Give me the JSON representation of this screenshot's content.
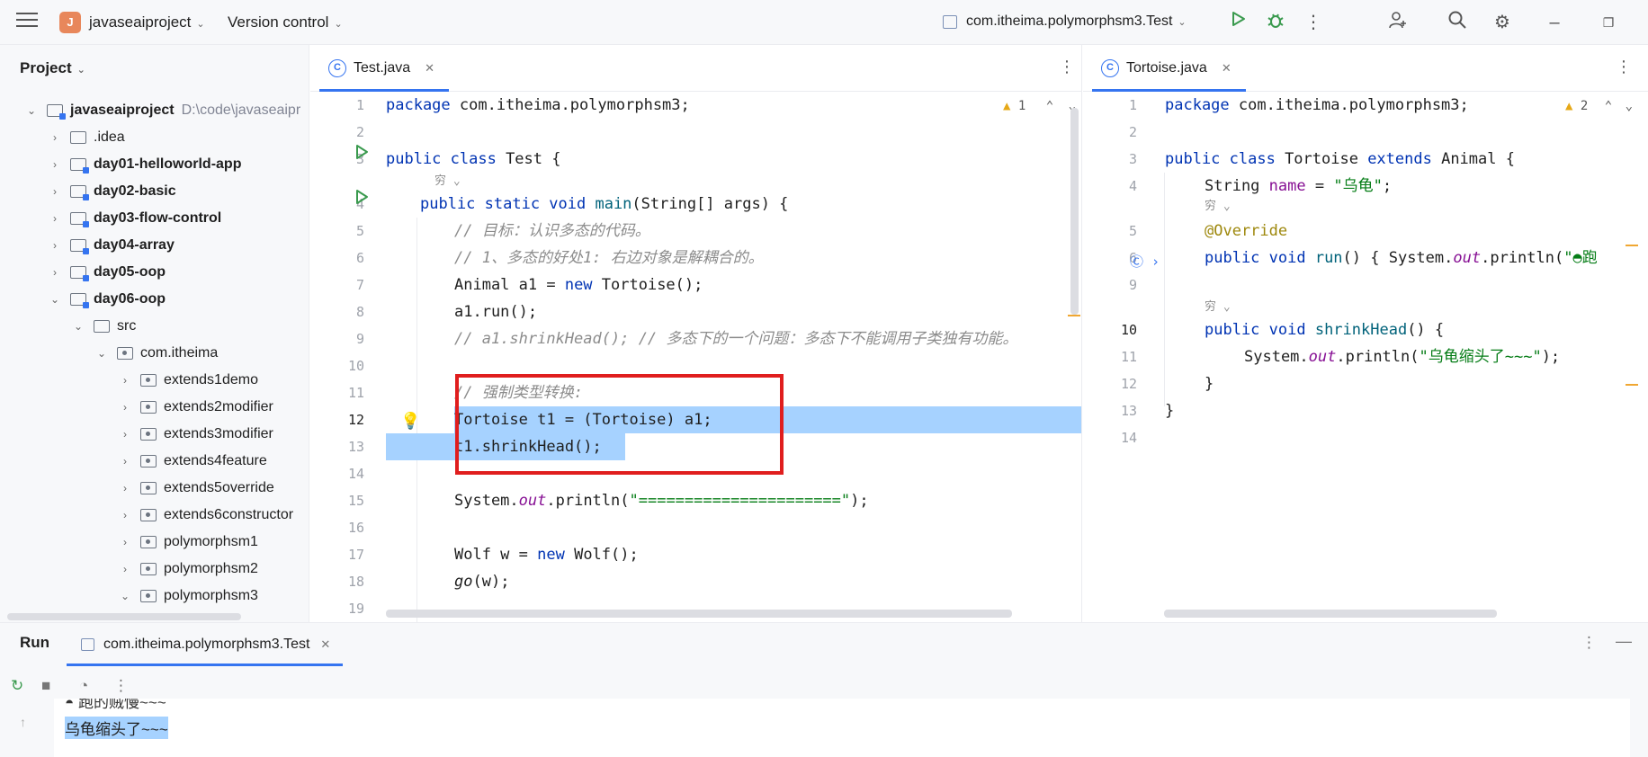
{
  "titlebar": {
    "project_badge": "J",
    "project_name": "javaseaiproject",
    "version_control": "Version control",
    "run_config": "com.itheima.polymorphsm3.Test"
  },
  "project_panel": {
    "header": "Project",
    "tree": [
      {
        "label": "javaseaiproject",
        "path": "D:\\code\\javaseaipr",
        "level": 0,
        "expanded": true,
        "icon": "module-folder-icon",
        "bold": true
      },
      {
        "label": ".idea",
        "level": 1,
        "expanded": false,
        "icon": "folder-icon",
        "bold": false
      },
      {
        "label": "day01-helloworld-app",
        "level": 1,
        "expanded": false,
        "icon": "module-folder-icon",
        "bold": true
      },
      {
        "label": "day02-basic",
        "level": 1,
        "expanded": false,
        "icon": "module-folder-icon",
        "bold": true
      },
      {
        "label": "day03-flow-control",
        "level": 1,
        "expanded": false,
        "icon": "module-folder-icon",
        "bold": true
      },
      {
        "label": "day04-array",
        "level": 1,
        "expanded": false,
        "icon": "module-folder-icon",
        "bold": true
      },
      {
        "label": "day05-oop",
        "level": 1,
        "expanded": false,
        "icon": "module-folder-icon",
        "bold": true
      },
      {
        "label": "day06-oop",
        "level": 1,
        "expanded": true,
        "icon": "module-folder-icon",
        "bold": true
      },
      {
        "label": "src",
        "level": 2,
        "expanded": true,
        "icon": "source-folder-icon",
        "bold": false
      },
      {
        "label": "com.itheima",
        "level": 3,
        "expanded": true,
        "icon": "package-icon",
        "bold": false
      },
      {
        "label": "extends1demo",
        "level": 4,
        "expanded": false,
        "icon": "package-icon",
        "bold": false
      },
      {
        "label": "extends2modifier",
        "level": 4,
        "expanded": false,
        "icon": "package-icon",
        "bold": false
      },
      {
        "label": "extends3modifier",
        "level": 4,
        "expanded": false,
        "icon": "package-icon",
        "bold": false
      },
      {
        "label": "extends4feature",
        "level": 4,
        "expanded": false,
        "icon": "package-icon",
        "bold": false
      },
      {
        "label": "extends5override",
        "level": 4,
        "expanded": false,
        "icon": "package-icon",
        "bold": false
      },
      {
        "label": "extends6constructor",
        "level": 4,
        "expanded": false,
        "icon": "package-icon",
        "bold": false
      },
      {
        "label": "polymorphsm1",
        "level": 4,
        "expanded": false,
        "icon": "package-icon",
        "bold": false
      },
      {
        "label": "polymorphsm2",
        "level": 4,
        "expanded": false,
        "icon": "package-icon",
        "bold": false
      },
      {
        "label": "polymorphsm3",
        "level": 4,
        "expanded": true,
        "icon": "package-icon",
        "bold": false
      }
    ]
  },
  "left_editor": {
    "tab_label": "Test.java",
    "warnings": "1",
    "line_numbers": [
      "1",
      "2",
      "3",
      "4",
      "5",
      "6",
      "7",
      "8",
      "9",
      "10",
      "11",
      "12",
      "13",
      "14",
      "15",
      "16",
      "17",
      "18",
      "19"
    ],
    "code": {
      "l1_kw": "package",
      "l1_rest": " com.itheima.polymorphsm3;",
      "l3_kw": "public class",
      "l3_rest": " Test {",
      "l4_hint": "穷",
      "l4_kw": "public static void",
      "l4_fn": " main",
      "l4_rest": "(String[] args) {",
      "l5": "// 目标：认识多态的代码。",
      "l6": "// 1、多态的好处1: 右边对象是解耦合的。",
      "l7_a": "Animal a1 = ",
      "l7_kw": "new",
      "l7_b": " Tortoise();",
      "l8": "a1.run();",
      "l9": "// a1.shrinkHead(); // 多态下的一个问题：多态下不能调用子类独有功能。",
      "l11": "// 强制类型转换:",
      "l12": "Tortoise t1 = (Tortoise) a1;",
      "l13": "t1.shrinkHead();",
      "l15_a": "System.",
      "l15_st": "out",
      "l15_b": ".println(",
      "l15_str": "\"======================\"",
      "l15_c": ");",
      "l17_a": "Wolf w = ",
      "l17_kw": "new",
      "l17_b": " Wolf();",
      "l18_fn": "go",
      "l18_b": "(w);"
    }
  },
  "right_editor": {
    "tab_label": "Tortoise.java",
    "warnings": "2",
    "line_numbers": [
      "1",
      "2",
      "3",
      "4",
      "5",
      "6",
      "9",
      "10",
      "11",
      "12",
      "13",
      "14"
    ],
    "code": {
      "l1_kw": "package",
      "l1_rest": " com.itheima.polymorphsm3;",
      "l3_kw": "public class",
      "l3_a": " Tortoise ",
      "l3_kw2": "extends",
      "l3_b": " Animal {",
      "l4_a": "String ",
      "l4_fld": "name",
      "l4_b": " = ",
      "l4_str": "\"乌龟\"",
      "l4_c": ";",
      "hint": "穷",
      "l5": "@Override",
      "l6_kw": "public void",
      "l6_fn": " run",
      "l6_a": "() { System.",
      "l6_st": "out",
      "l6_b": ".println(",
      "l6_str": "\"◓跑",
      "l10_kw": "public void",
      "l10_fn": " shrinkHead",
      "l10_a": "() {",
      "l11_a": "System.",
      "l11_st": "out",
      "l11_b": ".println(",
      "l11_str": "\"乌龟缩头了~~~\"",
      "l11_c": ");",
      "l12": "}",
      "l13": "}"
    }
  },
  "run_panel": {
    "title": "Run",
    "tab_label": "com.itheima.polymorphsm3.Test",
    "console_line_1": "◓ 跑的贼慢~~~",
    "console_line_2": "乌龟缩头了~~~"
  },
  "colors": {
    "accent": "#3574f0",
    "selection": "#a6d2ff",
    "annotation_box": "#e01e1e",
    "run_green": "#3a9a4e"
  }
}
